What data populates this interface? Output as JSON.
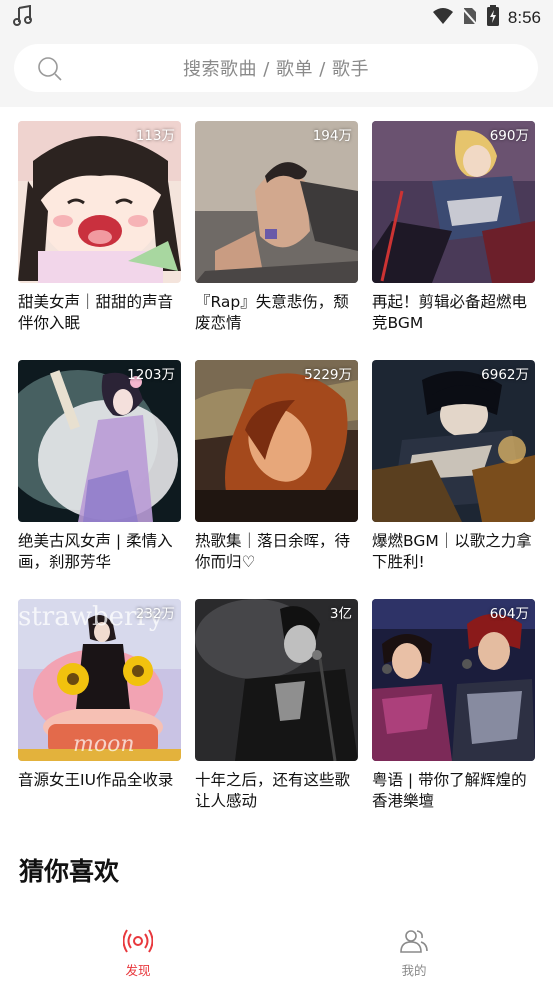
{
  "status_bar": {
    "time": "8:56",
    "icons": [
      "music-note-icon",
      "wifi-icon",
      "no-sim-icon",
      "battery-charging-icon"
    ]
  },
  "search": {
    "placeholder": "搜索歌曲 / 歌单 / 歌手",
    "icon": "search-icon"
  },
  "playlists": [
    {
      "count": "113万",
      "title": "甜美女声｜甜甜的声音伴你入眠"
    },
    {
      "count": "194万",
      "title": "『Rap』失意悲伤，颓废恋情"
    },
    {
      "count": "690万",
      "title": "再起！剪辑必备超燃电竞BGM"
    },
    {
      "count": "1203万",
      "title": "绝美古风女声 | 柔情入画，刹那芳华"
    },
    {
      "count": "5229万",
      "title": "热歌集｜落日余晖，待你而归♡"
    },
    {
      "count": "6962万",
      "title": "爆燃BGM｜以歌之力拿下胜利!"
    },
    {
      "count": "232万",
      "title": "音源女王IU作品全收录"
    },
    {
      "count": "3亿",
      "title": "十年之后，还有这些歌让人感动"
    },
    {
      "count": "604万",
      "title": "粤语 | 带你了解辉煌的香港樂壇"
    }
  ],
  "section": {
    "title": "猜你喜欢"
  },
  "bottom_nav": {
    "items": [
      {
        "label": "发现",
        "icon": "radio-broadcast-icon",
        "active": true
      },
      {
        "label": "我的",
        "icon": "users-icon",
        "active": false
      }
    ],
    "active_color": "#e8383d",
    "inactive_color": "#8a8a8a"
  }
}
